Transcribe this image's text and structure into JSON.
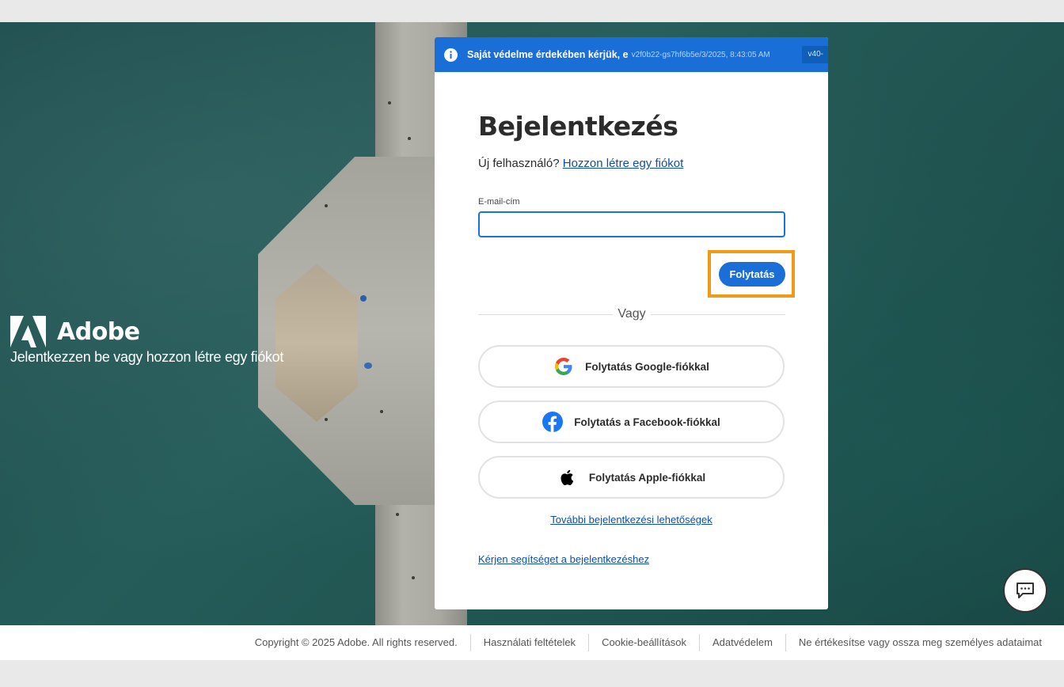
{
  "brand": {
    "name": "Adobe",
    "tagline": "Jelentkezzen be vagy hozzon létre egy fiókot",
    "logo_icon": "adobe-logo-icon"
  },
  "banner": {
    "text": "Saját védelme érdekében kérjük, e",
    "meta": "v2f0b22-gs7hf6b5e/3/2025, 8:43:05 AM",
    "version": "v40-",
    "icon": "info-icon",
    "color": "#1a6ed8"
  },
  "login": {
    "title": "Bejelentkezés",
    "new_user_text": "Új felhasználó?",
    "create_account_link": "Hozzon létre egy fiókot",
    "email_label": "E-mail-cím",
    "email_value": "",
    "continue_label": "Folytatás",
    "or_text": "Vagy",
    "google_label": "Folytatás Google-fiókkal",
    "facebook_label": "Folytatás a Facebook-fiókkal",
    "apple_label": "Folytatás Apple-fiókkal",
    "more_options_link": "További bejelentkezési lehetőségek",
    "help_link": "Kérjen segítséget a bejelentkezéshez",
    "highlight_color": "#f19a16"
  },
  "footer": {
    "items": [
      "Copyright © 2025 Adobe. All rights reserved.",
      "Használati feltételek",
      "Cookie-beállítások",
      "Adatvédelem",
      "Ne értékesítse vagy ossza meg személyes adataimat"
    ]
  },
  "chat": {
    "icon": "chat-bubble-icon"
  }
}
